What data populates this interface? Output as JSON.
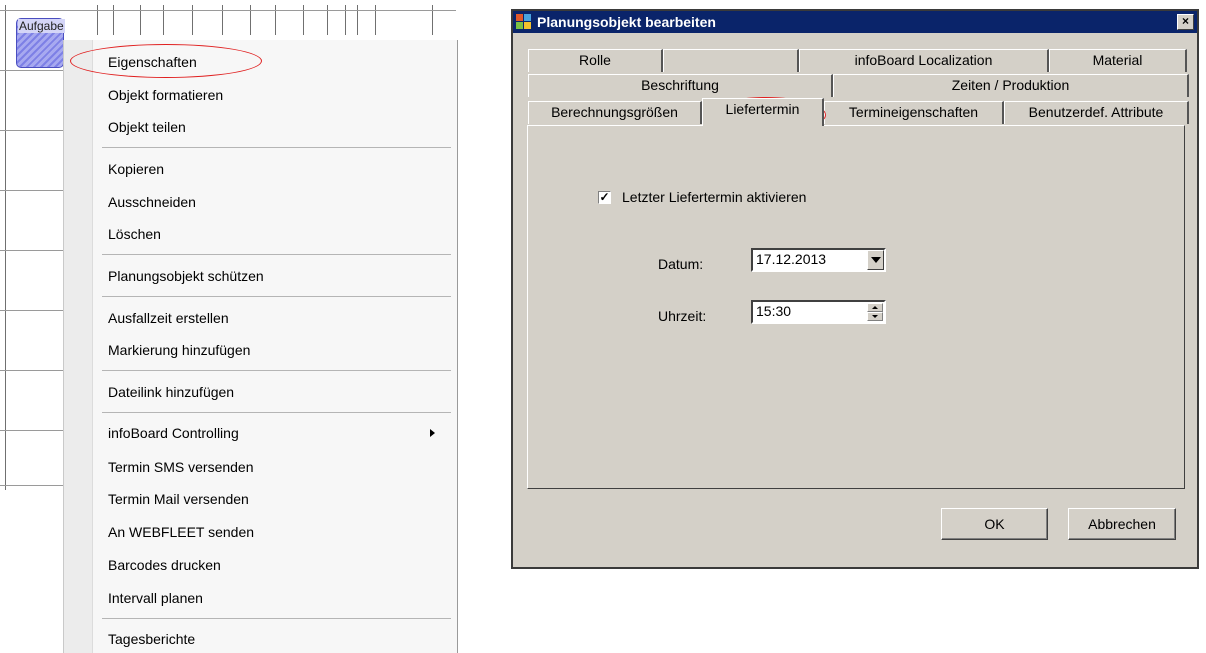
{
  "task": {
    "label": "Aufgabe"
  },
  "context_menu": {
    "items": [
      {
        "label": "Eigenschaften"
      },
      {
        "label": "Objekt formatieren"
      },
      {
        "label": "Objekt teilen"
      },
      {
        "label": "Kopieren"
      },
      {
        "label": "Ausschneiden"
      },
      {
        "label": "Löschen"
      },
      {
        "label": "Planungsobjekt schützen"
      },
      {
        "label": "Ausfallzeit erstellen"
      },
      {
        "label": "Markierung hinzufügen"
      },
      {
        "label": "Dateilink hinzufügen"
      },
      {
        "label": "infoBoard Controlling"
      },
      {
        "label": "Termin SMS versenden"
      },
      {
        "label": "Termin Mail versenden"
      },
      {
        "label": "An WEBFLEET senden"
      },
      {
        "label": "Barcodes drucken"
      },
      {
        "label": "Intervall planen"
      },
      {
        "label": "Tagesberichte"
      }
    ]
  },
  "dialog": {
    "title": "Planungsobjekt bearbeiten",
    "close_label": "×",
    "tabs": {
      "row1": [
        "Rolle",
        "",
        "infoBoard Localization",
        "Material"
      ],
      "row2": [
        "Beschriftung",
        "Zeiten / Produktion"
      ],
      "row3": [
        "Berechnungsgrößen",
        "Liefertermin",
        "Termineigenschaften",
        "Benutzerdef. Attribute"
      ]
    },
    "active_tab": "Liefertermin",
    "checkbox": {
      "label": "Letzter Liefertermin aktivieren",
      "mark": "✓"
    },
    "datum": {
      "label": "Datum:",
      "value": "17.12.2013"
    },
    "uhrzeit": {
      "label": "Uhrzeit:",
      "value": "15:30"
    },
    "ok_label": "OK",
    "cancel_label": "Abbrechen"
  },
  "colors": {
    "title_bar": "#0a246a",
    "dialog_face": "#d4d0c8",
    "highlight_ellipse": "#e02020",
    "task_fill": "#8c8fe9"
  }
}
